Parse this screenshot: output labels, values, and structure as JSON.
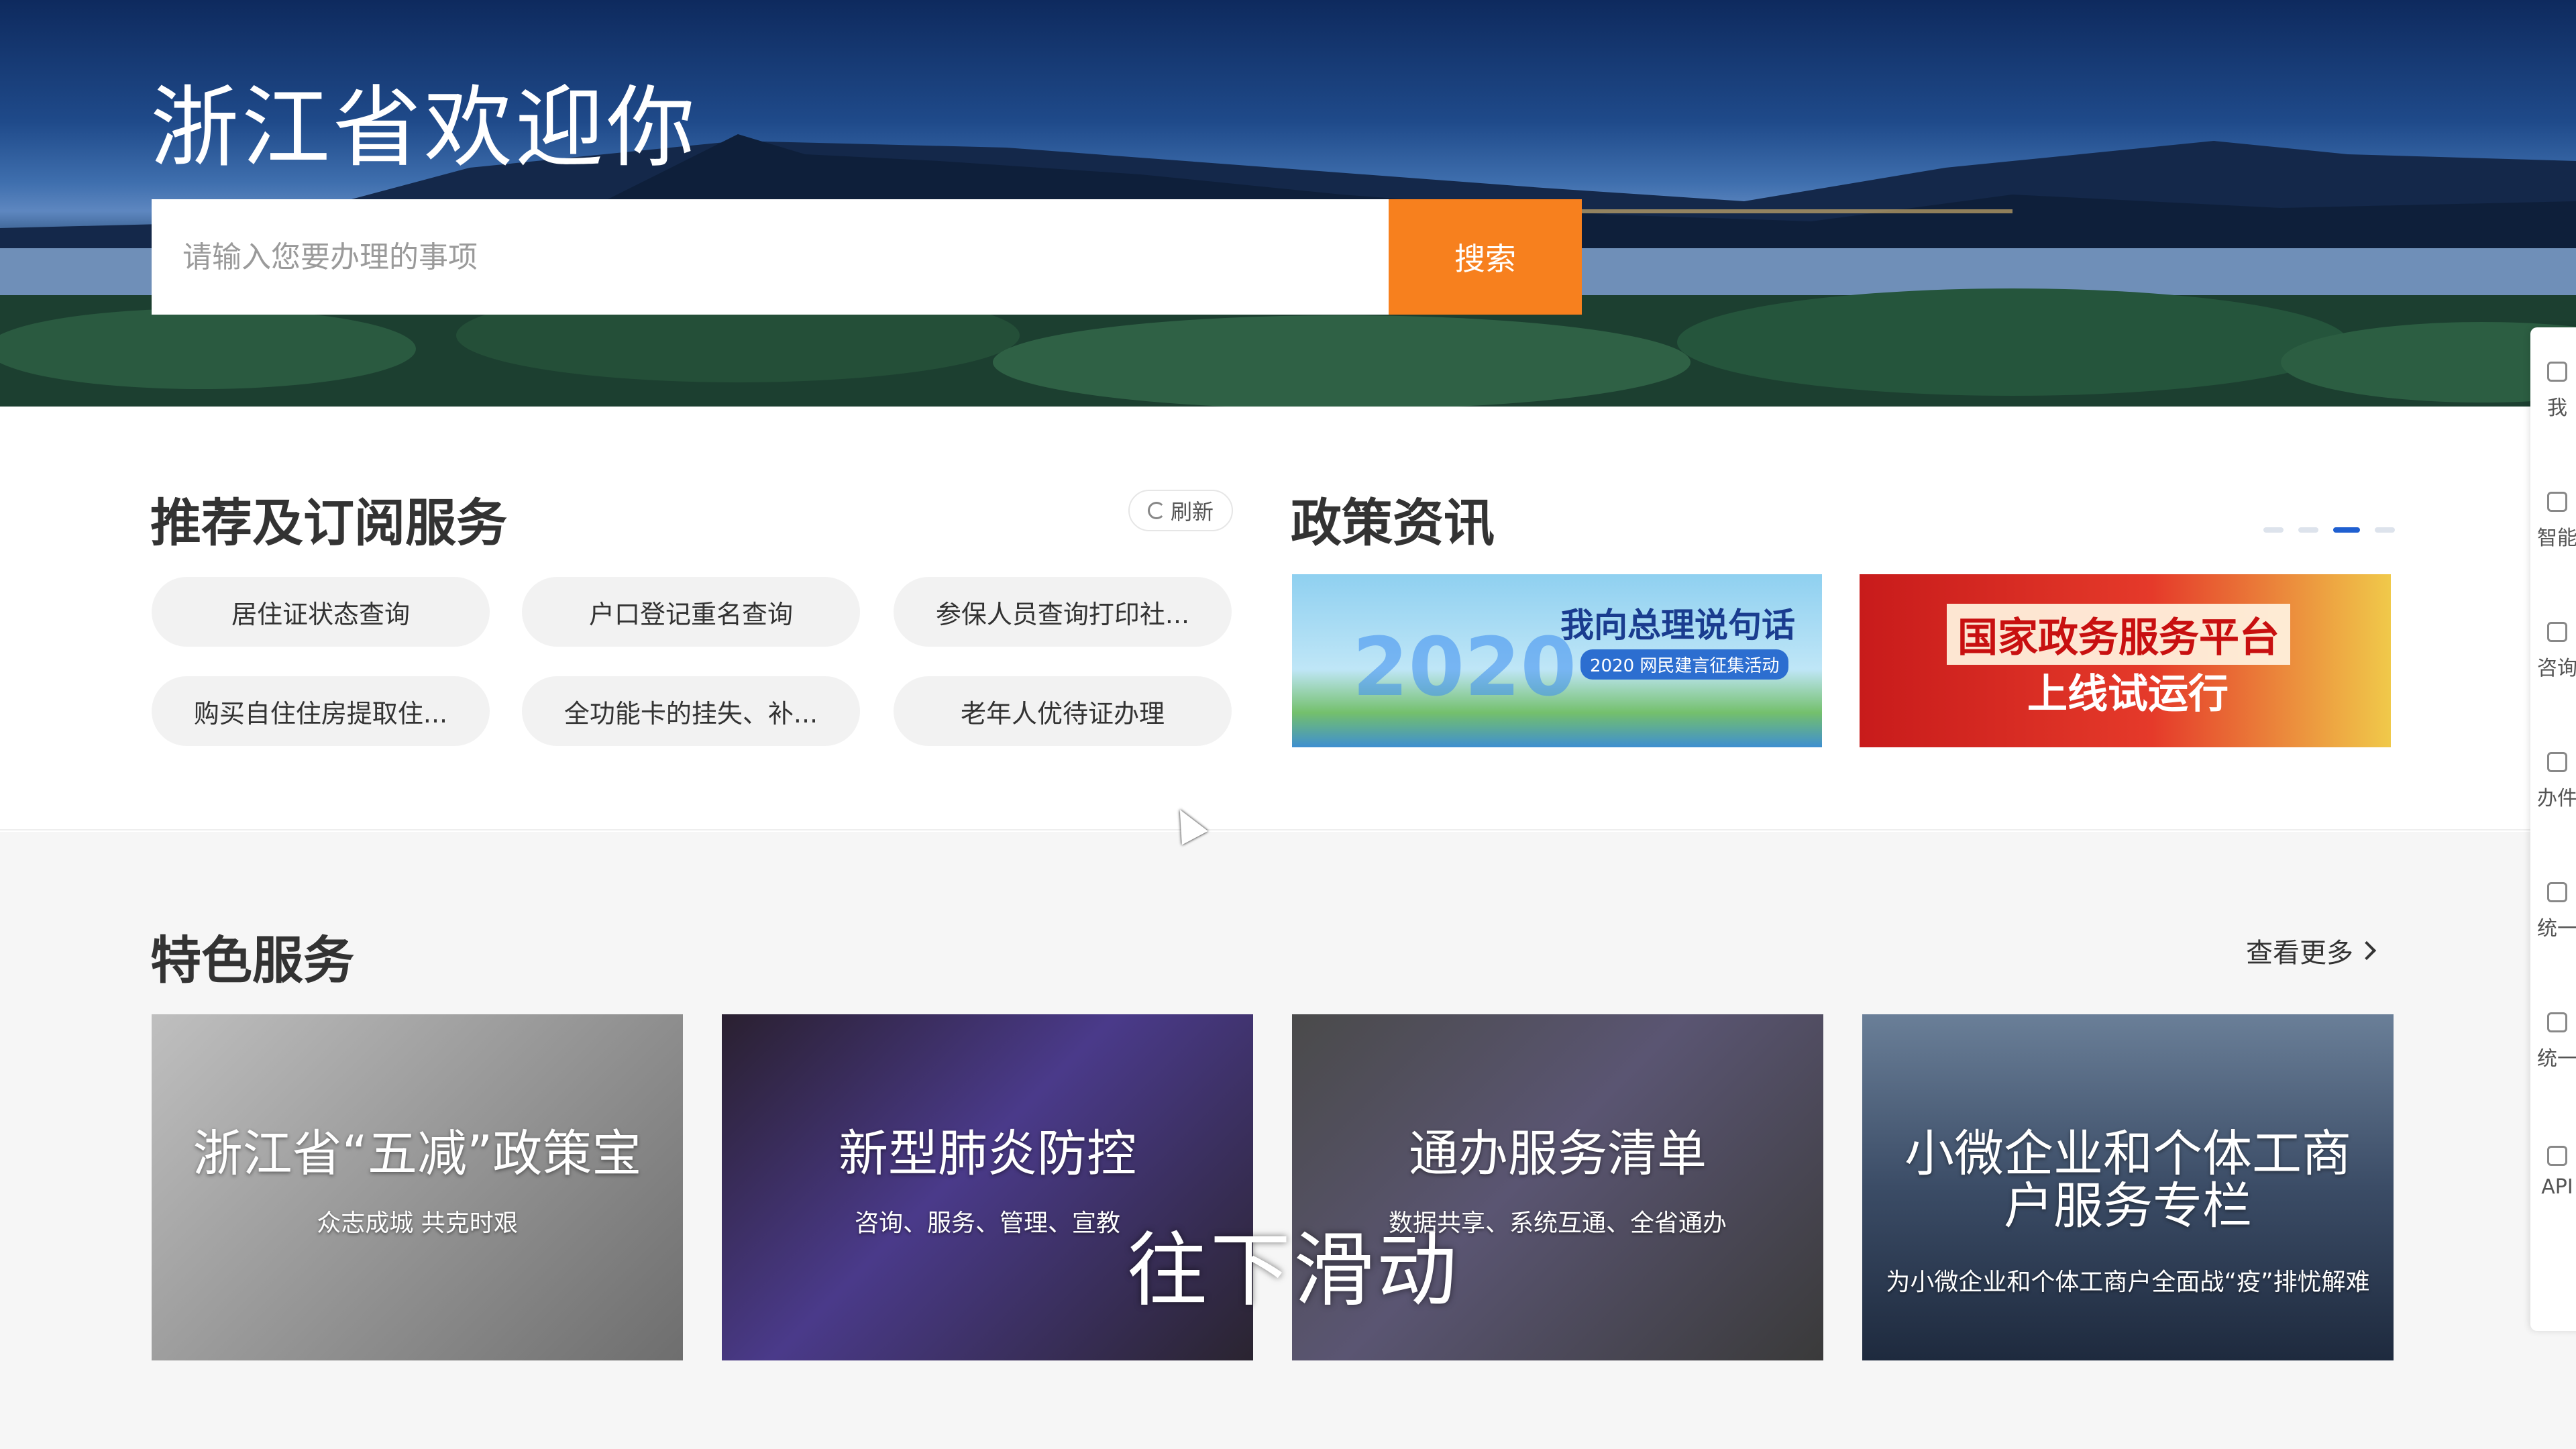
{
  "hero": {
    "title": "浙江省欢迎你",
    "search_placeholder": "请输入您要办理的事项",
    "search_button": "搜索"
  },
  "recommend": {
    "title": "推荐及订阅服务",
    "refresh_label": "刷新",
    "items": [
      "居住证状态查询",
      "户口登记重名查询",
      "参保人员查询打印社...",
      "购买自住住房提取住...",
      "全功能卡的挂失、补...",
      "老年人优待证办理"
    ]
  },
  "policy": {
    "title": "政策资讯",
    "carousel_page_count": 4,
    "carousel_active_index": 2,
    "banners": [
      {
        "year": "2020",
        "title": "我向总理说句话",
        "subtitle": "2020 网民建言征集活动"
      },
      {
        "line1": "国家政务服务平台",
        "line2": "上线试运行"
      }
    ]
  },
  "featured": {
    "title": "特色服务",
    "more_label": "查看更多",
    "cards": [
      {
        "title": "浙江省“五减”政策宝",
        "subtitle": "众志成城 共克时艰"
      },
      {
        "title": "新型肺炎防控",
        "subtitle": "咨询、服务、管理、宣教"
      },
      {
        "title": "通办服务清单",
        "subtitle": "数据共享、系统互通、全省通办"
      },
      {
        "title": "小微企业和个体工商户服务专栏",
        "subtitle": "为小微企业和个体工商户全面战“疫”排忧解难"
      }
    ]
  },
  "overlay_caption": "往下滑动",
  "sidebar": {
    "items": [
      "我",
      "智能",
      "咨询",
      "办件",
      "统一",
      "统一",
      "API"
    ]
  },
  "colors": {
    "accent_orange": "#f7801e",
    "carousel_active": "#1f5fd0",
    "section_bg": "#f6f6f6"
  }
}
